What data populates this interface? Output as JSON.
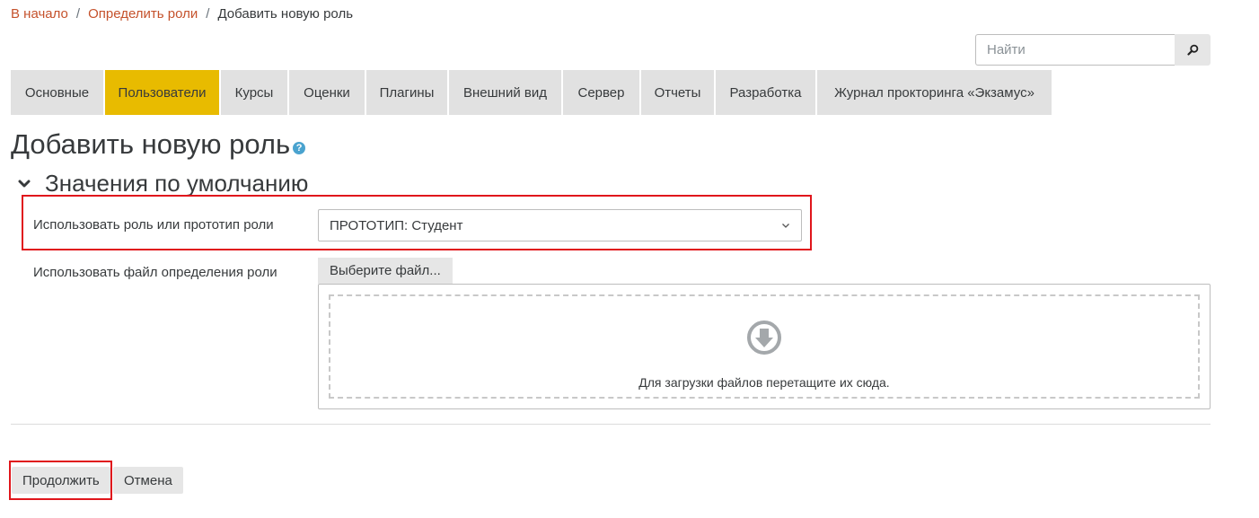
{
  "breadcrumb": {
    "items": [
      {
        "label": "В начало"
      },
      {
        "label": "Определить роли"
      }
    ],
    "separator": "/",
    "current": "Добавить новую роль"
  },
  "search": {
    "placeholder": "Найти",
    "icon": "search-icon"
  },
  "tabs": [
    {
      "label": "Основные",
      "active": false
    },
    {
      "label": "Пользователи",
      "active": true
    },
    {
      "label": "Курсы",
      "active": false
    },
    {
      "label": "Оценки",
      "active": false
    },
    {
      "label": "Плагины",
      "active": false
    },
    {
      "label": "Внешний вид",
      "active": false
    },
    {
      "label": "Сервер",
      "active": false
    },
    {
      "label": "Отчеты",
      "active": false
    },
    {
      "label": "Разработка",
      "active": false
    },
    {
      "label": "Журнал прокторинга «Экзамус»",
      "active": false
    }
  ],
  "page": {
    "title": "Добавить новую роль",
    "help_icon": "question-circle-icon",
    "help_glyph": "?"
  },
  "section": {
    "title": "Значения по умолчанию",
    "toggle_icon": "chevron-down-icon"
  },
  "form": {
    "role_label": "Использовать роль или прототип роли",
    "role_value": "ПРОТОТИП: Студент",
    "file_label": "Использовать файл определения роли",
    "file_button": "Выберите файл...",
    "dropzone_text": "Для загрузки файлов перетащите их сюда.",
    "dropzone_icon": "download-circle-icon"
  },
  "actions": {
    "continue": "Продолжить",
    "cancel": "Отмена"
  },
  "colors": {
    "link": "#c5522c",
    "active_tab": "#e8bb00",
    "tab": "#e1e1e1",
    "highlight": "#e0161c",
    "help": "#4aa3cf"
  }
}
